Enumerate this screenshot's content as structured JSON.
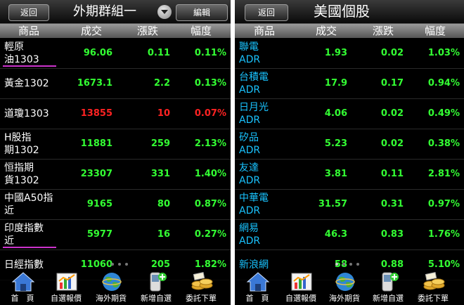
{
  "left": {
    "back_label": "返回",
    "title": "外期群組一",
    "edit_label": "編輯",
    "columns": [
      "商品",
      "成交",
      "漲跌",
      "幅度"
    ],
    "rows": [
      {
        "name1": "輕原",
        "name2": "油1303",
        "price": "96.06",
        "change": "0.11",
        "pct": "0.11%",
        "color": "g"
      },
      {
        "name1": "黃金1302",
        "name2": "",
        "price": "1673.1",
        "change": "2.2",
        "pct": "0.13%",
        "color": "g"
      },
      {
        "name1": "道瓊1303",
        "name2": "",
        "price": "13855",
        "change": "10",
        "pct": "0.07%",
        "color": "r"
      },
      {
        "name1": "H股指",
        "name2": "期1302",
        "price": "11881",
        "change": "259",
        "pct": "2.13%",
        "color": "g"
      },
      {
        "name1": "恒指期",
        "name2": "貨1302",
        "price": "23307",
        "change": "331",
        "pct": "1.40%",
        "color": "g"
      },
      {
        "name1": "中國A50指",
        "name2": "近",
        "price": "9165",
        "change": "80",
        "pct": "0.87%",
        "color": "g"
      },
      {
        "name1": "印度指數",
        "name2": "近",
        "price": "5977",
        "change": "16",
        "pct": "0.27%",
        "color": "g"
      },
      {
        "name1": "日經指數",
        "name2": "",
        "price": "11060",
        "change": "205",
        "pct": "1.82%",
        "color": "g"
      }
    ]
  },
  "right": {
    "back_label": "返回",
    "title": "美國個股",
    "columns": [
      "商品",
      "成交",
      "漲跌",
      "幅度"
    ],
    "rows": [
      {
        "name1": "聯電",
        "name2": "ADR",
        "price": "1.93",
        "change": "0.02",
        "pct": "1.03%",
        "color": "g"
      },
      {
        "name1": "台積電",
        "name2": "ADR",
        "price": "17.9",
        "change": "0.17",
        "pct": "0.94%",
        "color": "g"
      },
      {
        "name1": "日月光",
        "name2": "ADR",
        "price": "4.06",
        "change": "0.02",
        "pct": "0.49%",
        "color": "g"
      },
      {
        "name1": "矽品",
        "name2": "ADR",
        "price": "5.23",
        "change": "0.02",
        "pct": "0.38%",
        "color": "g"
      },
      {
        "name1": "友達",
        "name2": "ADR",
        "price": "3.81",
        "change": "0.11",
        "pct": "2.81%",
        "color": "g"
      },
      {
        "name1": "中華電",
        "name2": "ADR",
        "price": "31.57",
        "change": "0.31",
        "pct": "0.97%",
        "color": "g"
      },
      {
        "name1": "網易",
        "name2": "ADR",
        "price": "46.3",
        "change": "0.83",
        "pct": "1.76%",
        "color": "g"
      },
      {
        "name1": "新浪網",
        "name2": "",
        "price": "58",
        "change": "0.88",
        "pct": "5.10%",
        "color": "g"
      }
    ]
  },
  "tabs": [
    {
      "label": "首　頁",
      "icon": "home-icon"
    },
    {
      "label": "自選報價",
      "icon": "chart-icon"
    },
    {
      "label": "海外期貨",
      "icon": "globe-icon"
    },
    {
      "label": "新增自選",
      "icon": "phone-add-icon"
    },
    {
      "label": "委託下單",
      "icon": "coins-icon"
    }
  ],
  "colors": {
    "up": "#33ff33",
    "down": "#ff2222",
    "header_bg": "#808080",
    "accent": "#cc33cc"
  }
}
